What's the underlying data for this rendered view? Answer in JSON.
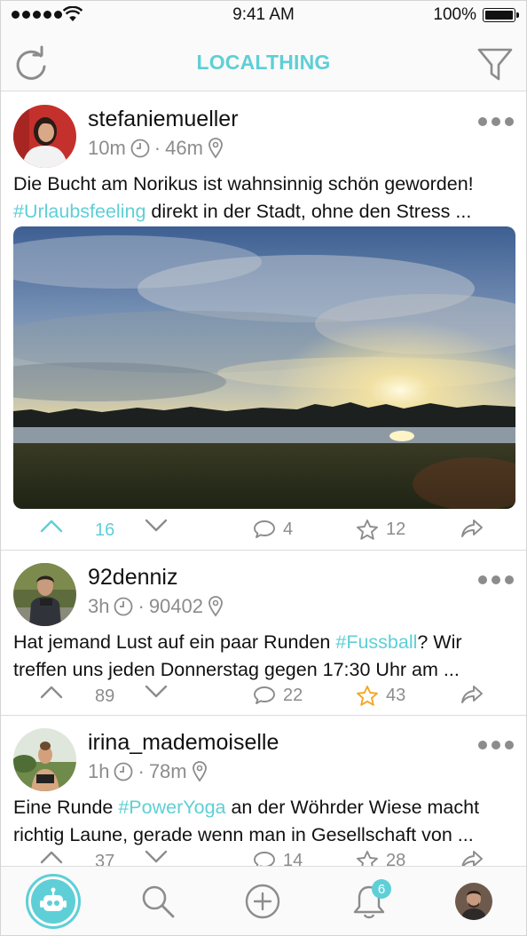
{
  "status_bar": {
    "time": "9:41 AM",
    "battery": "100%"
  },
  "nav": {
    "title": "LOCALTHING",
    "refresh_icon": "refresh-icon",
    "filter_icon": "filter-icon"
  },
  "posts": [
    {
      "username": "stefaniemueller",
      "age": "10m",
      "distance": "46m",
      "text_line1_a": "Die Bucht am Norikus ist wahnsinnig schön geworden!",
      "text_line2_tag": "#Urlaubsfeeling",
      "text_line2_b": " direkt in der Stadt, ohne den Stress ...",
      "votes": "16",
      "comments": "4",
      "stars": "12",
      "upvoted": true
    },
    {
      "username": "92denniz",
      "age": "3h",
      "distance": "90402",
      "text_line1_a": "Hat jemand Lust auf ein paar Runden ",
      "text_line1_tag": "#Fussball",
      "text_line1_b": "? Wir",
      "text_line2": "treffen uns jeden Donnerstag gegen 17:30 Uhr am ...",
      "votes": "89",
      "comments": "22",
      "stars": "43",
      "starred": true
    },
    {
      "username": "irina_mademoiselle",
      "age": "1h",
      "distance": "78m",
      "text_line1_a": "Eine Runde ",
      "text_line1_tag": "#PowerYoga",
      "text_line1_b": " an der Wöhrder Wiese macht",
      "text_line2": "richtig Laune, gerade wenn man in Gesellschaft von ...",
      "votes": "37",
      "comments": "14",
      "stars": "28"
    }
  ],
  "tab_bar": {
    "notification_count": "6"
  },
  "colors": {
    "accent": "#5ecfd6",
    "star_active": "#f5a623",
    "muted": "#8c8c8c"
  }
}
